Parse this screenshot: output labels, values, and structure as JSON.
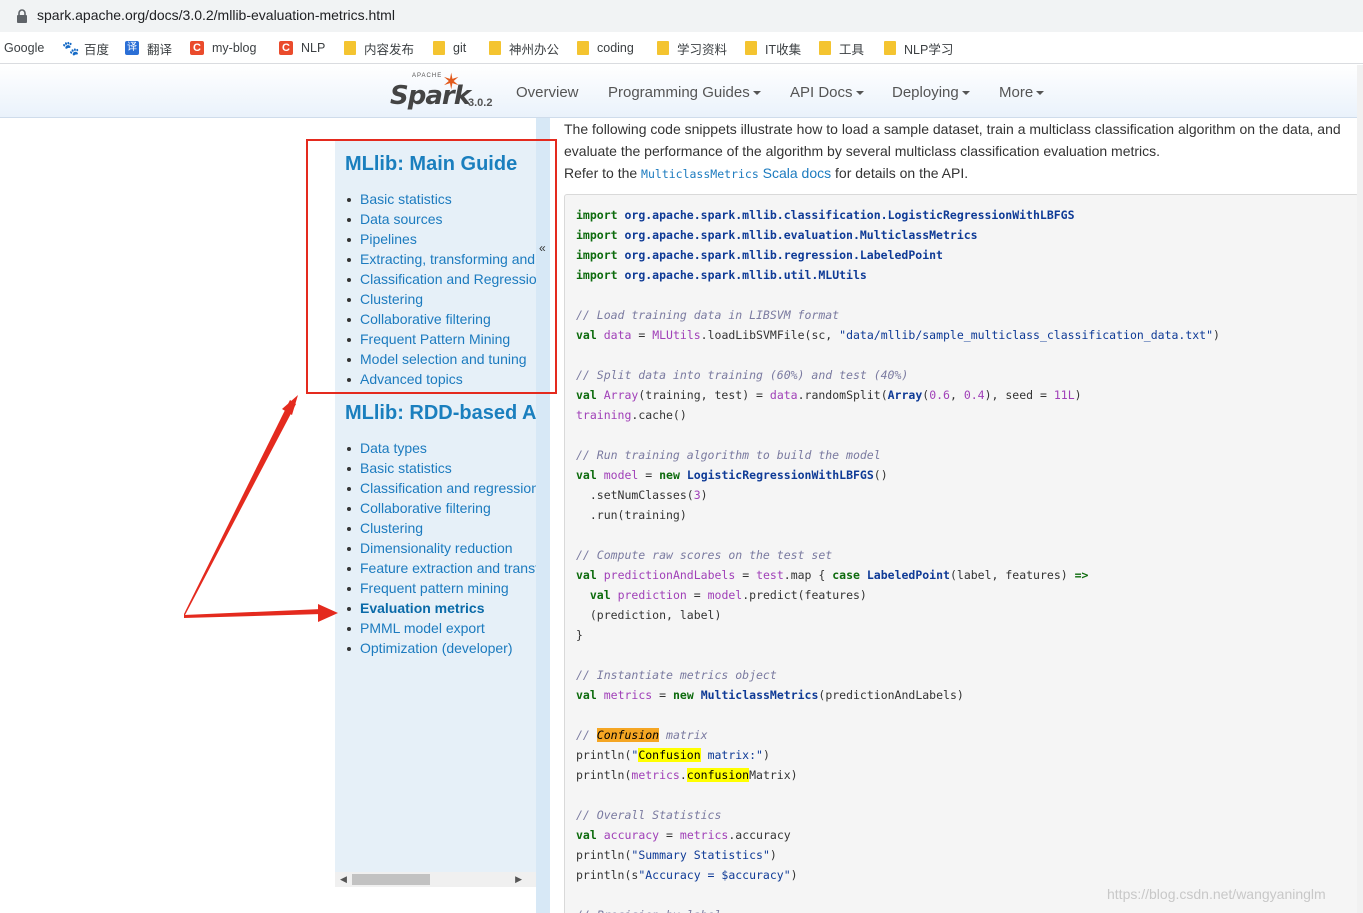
{
  "browser": {
    "url": "spark.apache.org/docs/3.0.2/mllib-evaluation-metrics.html",
    "bookmarks": [
      {
        "label": "Google",
        "icon": "none"
      },
      {
        "label": "百度",
        "icon": "baidu-paw-icon"
      },
      {
        "label": "翻译",
        "icon": "translate-icon"
      },
      {
        "label": "my-blog",
        "icon": "csdn-icon"
      },
      {
        "label": "NLP",
        "icon": "csdn-icon"
      },
      {
        "label": "内容发布",
        "icon": "folder-icon"
      },
      {
        "label": "git",
        "icon": "folder-icon"
      },
      {
        "label": "神州办公",
        "icon": "folder-icon"
      },
      {
        "label": "coding",
        "icon": "folder-icon"
      },
      {
        "label": "学习资料",
        "icon": "folder-icon"
      },
      {
        "label": "IT收集",
        "icon": "folder-icon"
      },
      {
        "label": "工具",
        "icon": "folder-icon"
      },
      {
        "label": "NLP学习",
        "icon": "folder-icon"
      }
    ]
  },
  "nav": {
    "logo_word": "Spark",
    "logo_apache": "APACHE",
    "version": "3.0.2",
    "items": [
      "Overview",
      "Programming Guides",
      "API Docs",
      "Deploying",
      "More"
    ]
  },
  "sidebar": {
    "main_guide": {
      "title": "MLlib: Main Guide",
      "items": [
        "Basic statistics",
        "Data sources",
        "Pipelines",
        "Extracting, transforming and selecting features",
        "Classification and Regression",
        "Clustering",
        "Collaborative filtering",
        "Frequent Pattern Mining",
        "Model selection and tuning",
        "Advanced topics"
      ]
    },
    "rdd_based": {
      "title": "MLlib: RDD-based API Guide",
      "items": [
        "Data types",
        "Basic statistics",
        "Classification and regression",
        "Collaborative filtering",
        "Clustering",
        "Dimensionality reduction",
        "Feature extraction and transformation",
        "Frequent pattern mining",
        "Evaluation metrics",
        "PMML model export",
        "Optimization (developer)"
      ],
      "active": "Evaluation metrics"
    },
    "collapse_glyph": "«"
  },
  "content": {
    "intro_line1": "The following code snippets illustrate how to load a sample dataset, train a multiclass classification algorithm on the data, and",
    "intro_line2": "evaluate the performance of the algorithm by several multiclass classification evaluation metrics.",
    "refer_prefix": "Refer to the ",
    "refer_code": "MulticlassMetrics",
    "refer_link": " Scala docs",
    "refer_suffix": " for details on the API."
  },
  "watermark": "https://blog.csdn.net/wangyaninglm"
}
